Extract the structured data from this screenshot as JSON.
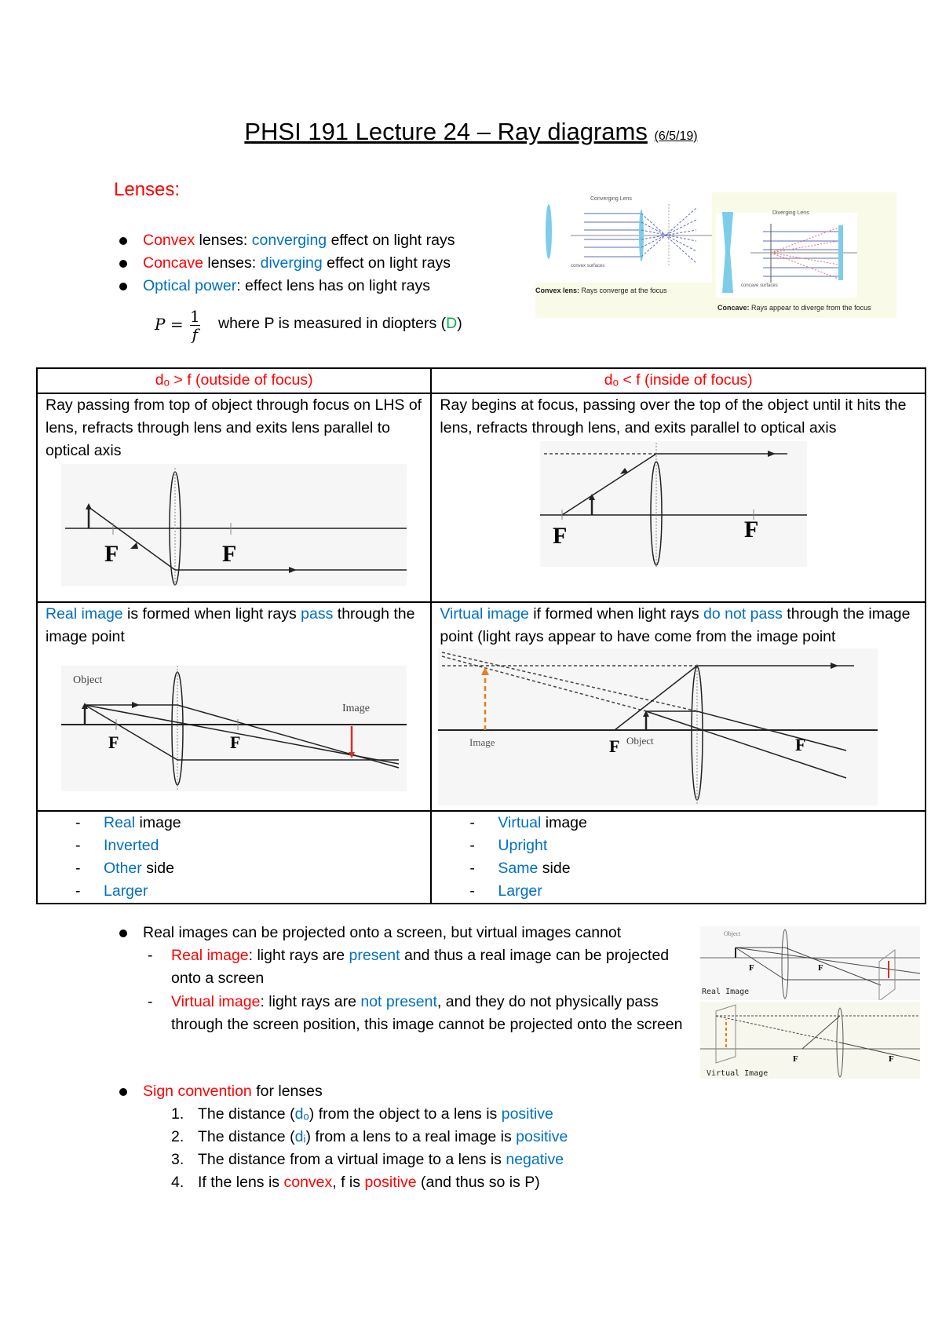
{
  "title": {
    "main": "PHSI 191 Lecture 24 – Ray diagrams",
    "date": "(6/5/19)"
  },
  "lenses_heading": "Lenses:",
  "bullets": [
    {
      "parts": [
        {
          "t": "Convex",
          "c": "red"
        },
        {
          "t": " lenses: ",
          "c": ""
        },
        {
          "t": "converging",
          "c": "blue"
        },
        {
          "t": " effect on light rays",
          "c": ""
        }
      ]
    },
    {
      "parts": [
        {
          "t": "Concave",
          "c": "red"
        },
        {
          "t": " lenses: ",
          "c": ""
        },
        {
          "t": "diverging",
          "c": "blue"
        },
        {
          "t": " effect on light rays",
          "c": ""
        }
      ]
    },
    {
      "parts": [
        {
          "t": "Optical power",
          "c": "blue"
        },
        {
          "t": ": effect lens has on light rays",
          "c": ""
        }
      ]
    }
  ],
  "formula": {
    "lhs": "P =",
    "numerator": "1",
    "denominator": "f",
    "note_prefix": "where P is measured in diopters (",
    "note_unit": "D",
    "note_suffix": ")"
  },
  "top_figure": {
    "left_title": "Converging Lens",
    "left_label": "convex surfaces",
    "left_caption_bold": "Convex lens:",
    "left_caption": " Rays converge at the focus",
    "right_title": "Diverging Lens",
    "right_label": "concave surfaces",
    "right_caption_bold": "Concave:",
    "right_caption": " Rays appear to diverge from the focus"
  },
  "table": {
    "col1_header": "dₒ > f (outside of focus)",
    "col2_header": "dₒ < f (inside of focus)",
    "col1_desc": "Ray passing from top of object through focus on LHS of lens, refracts through lens and exits lens parallel to optical axis",
    "col2_desc": "Ray begins at focus, passing over the top of the object until it hits the lens, refracts through lens, and exits parallel to optical axis",
    "focus_label": "F",
    "col1_real": {
      "a": "Real image",
      "b": " is formed when light rays ",
      "c": "pass",
      "d": " through the image point"
    },
    "col2_virtual": {
      "a": "Virtual image",
      "b": " if formed when light rays ",
      "c": "do not pass",
      "d": " through the image point (light rays appear to have come from the image point"
    },
    "object_label": "Object",
    "image_label": "Image",
    "col1_props": [
      {
        "hl": "Real",
        "rest": " image"
      },
      {
        "hl": "Inverted",
        "rest": ""
      },
      {
        "hl": "Other",
        "rest": " side"
      },
      {
        "hl": "Larger",
        "rest": ""
      }
    ],
    "col2_props": [
      {
        "hl": "Virtual",
        "rest": " image"
      },
      {
        "hl": "Upright",
        "rest": ""
      },
      {
        "hl": "Same",
        "rest": " side"
      },
      {
        "hl": "Larger",
        "rest": ""
      }
    ]
  },
  "projection": {
    "bullet": "Real images can be projected onto a screen, but virtual images cannot",
    "real": {
      "a": "Real image",
      "b": ": light rays are ",
      "c": "present",
      "d": " and thus a real image can be projected onto a screen"
    },
    "virtual": {
      "a": "Virtual image",
      "b": ": light rays are ",
      "c": "not present",
      "d": ", and they do not physically pass through the screen position, this image cannot be projected onto the screen"
    },
    "thumb_real_caption": "Real Image",
    "thumb_virtual_caption": "Virtual Image"
  },
  "sign": {
    "heading_hl": "Sign convention",
    "heading_rest": " for lenses",
    "items": [
      {
        "n": "1.",
        "a": "The distance (",
        "sym": "dₒ",
        "b": ") from the object to a lens is ",
        "hl": "positive",
        "hlc": "blue",
        "c": ""
      },
      {
        "n": "2.",
        "a": "The distance (",
        "sym": "dᵢ",
        "b": ") from a lens to a real image is ",
        "hl": "positive",
        "hlc": "blue",
        "c": ""
      },
      {
        "n": "3.",
        "a": "The distance from a virtual image to a lens is ",
        "sym": "",
        "b": "",
        "hl": "negative",
        "hlc": "blue",
        "c": ""
      },
      {
        "n": "4.",
        "a": "If the lens is ",
        "sym": "",
        "b": "",
        "hl": "",
        "hlc": "",
        "c": ""
      }
    ],
    "item4": {
      "a": "If the lens is ",
      "b": "convex",
      "c": ", f is ",
      "d": "positive",
      "e": " (and thus so is P)"
    }
  }
}
